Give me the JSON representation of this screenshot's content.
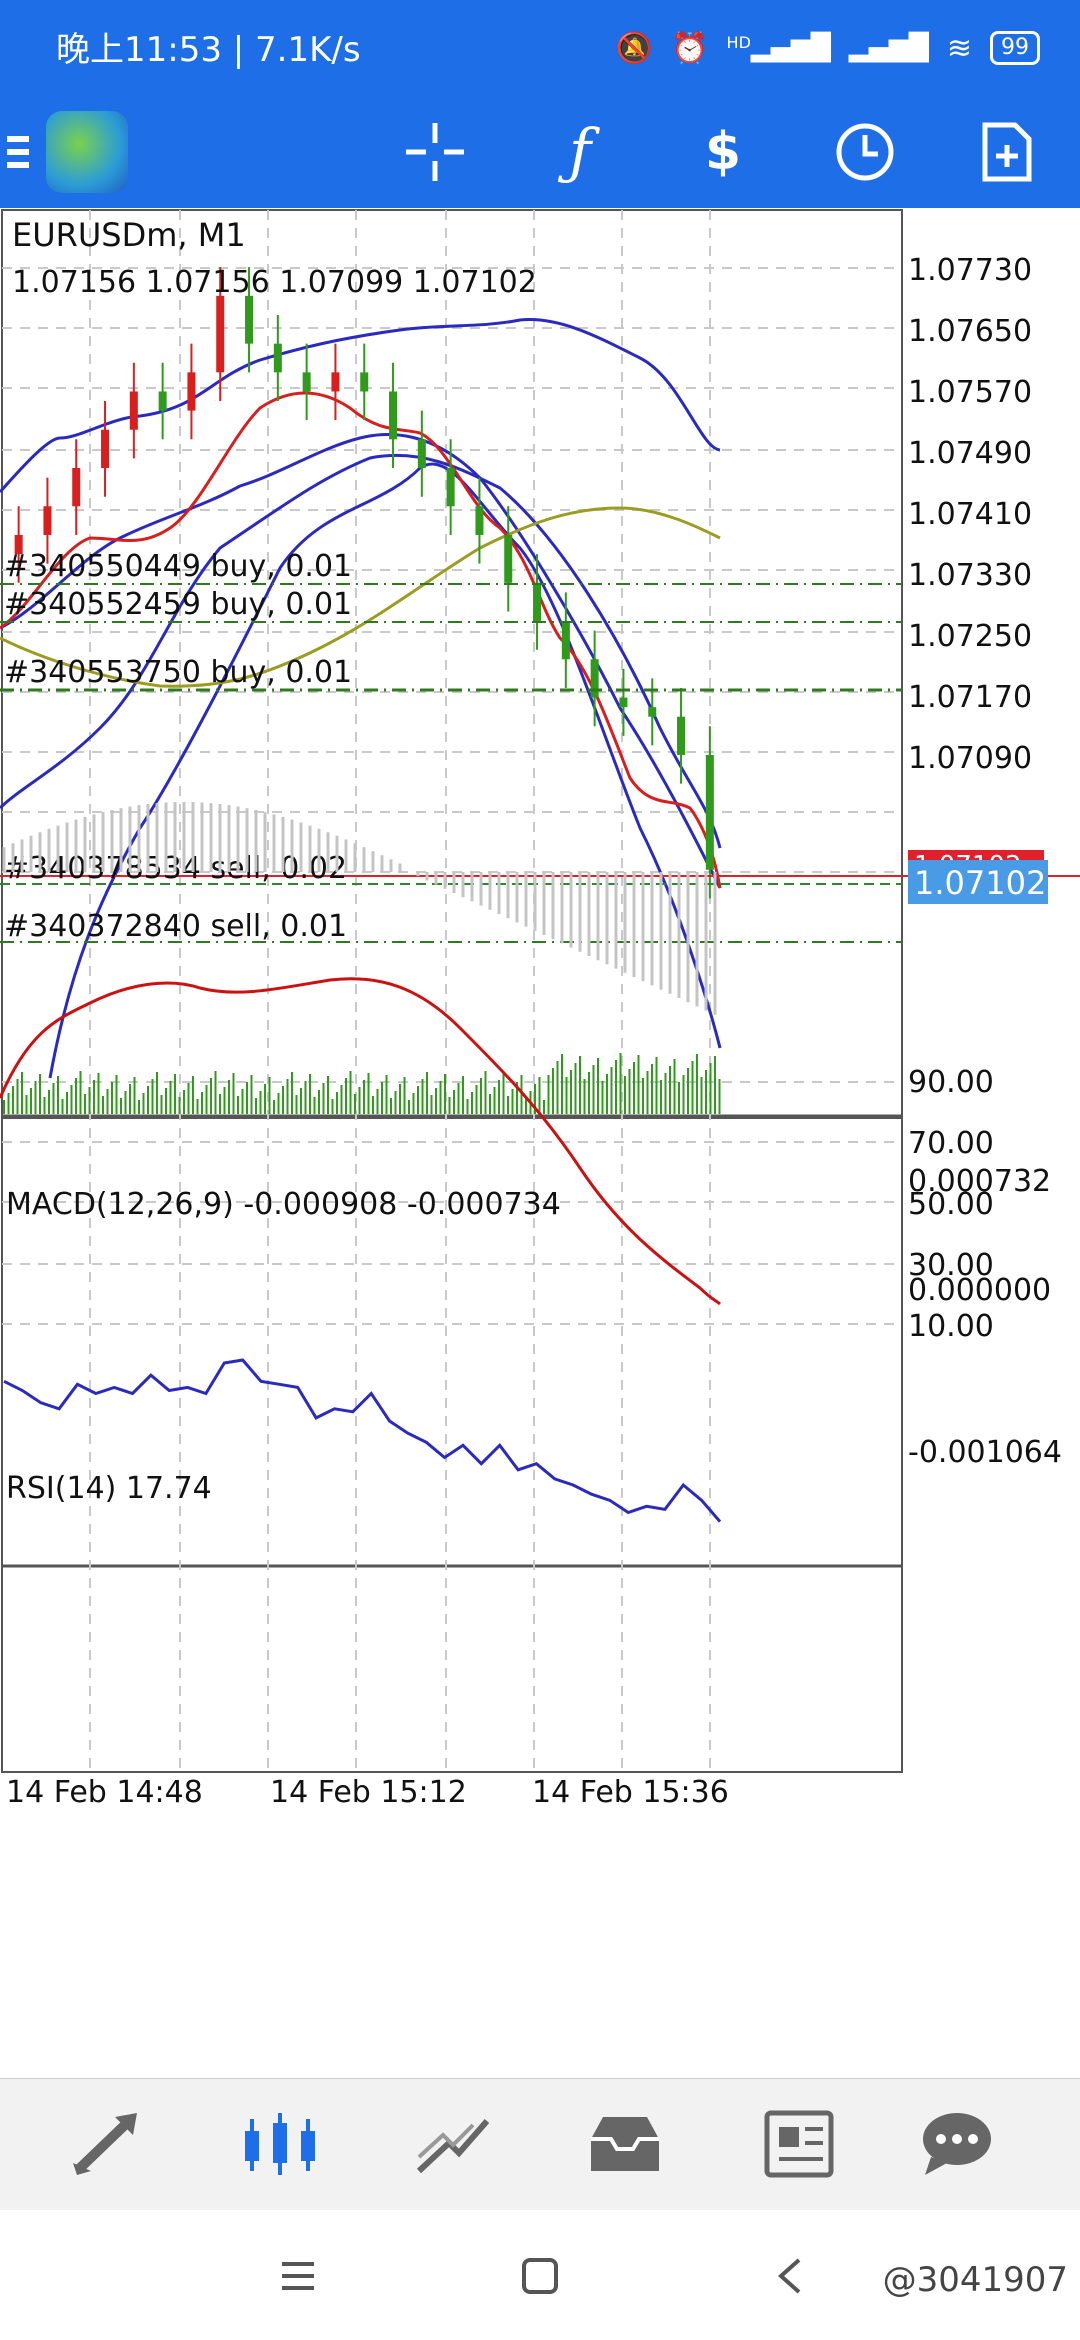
{
  "status_bar": {
    "time_text": "晚上11:53 | 7.1K/s",
    "signal_badge": "HD",
    "battery": "99"
  },
  "toolbar": {
    "icons": [
      "menu-icon",
      "app-logo",
      "crosshair-icon",
      "indicators-icon",
      "trade-icon",
      "timeframe-icon",
      "templates-icon"
    ]
  },
  "chart": {
    "symbol_label": "EURUSDm, M1",
    "ohlc_label": "1.07156 1.07156 1.07099 1.07102",
    "price_ticks": [
      "1.07730",
      "1.07650",
      "1.07570",
      "1.07490",
      "1.07410",
      "1.07330",
      "1.07250",
      "1.07170",
      "1.07090"
    ],
    "current_price": "1.07102",
    "red_tag": "1.07102",
    "orders": [
      {
        "label": "#340550449 buy, 0.01"
      },
      {
        "label": "#340552459 buy, 0.01"
      },
      {
        "label": "#340553750 buy, 0.01"
      },
      {
        "label": "#340378534 sell, 0.02"
      },
      {
        "label": "#340372840 sell, 0.01"
      }
    ],
    "macd_label": "MACD(12,26,9) -0.000908 -0.000734",
    "macd_ticks": [
      "0.000732",
      "0.000000",
      "-0.001064"
    ],
    "rsi_label": "RSI(14) 17.74",
    "rsi_ticks": [
      "90.00",
      "70.00",
      "50.00",
      "30.00",
      "10.00"
    ],
    "time_labels": [
      "14 Feb 14:48",
      "14 Feb 15:12",
      "14 Feb 15:36"
    ],
    "colors": {
      "bull": "#d91e1e",
      "bear": "#2f9a1c",
      "bands": "#2a2ac0",
      "ma": "#9c9c22",
      "macd_signal": "#cc1111",
      "grid": "#c9c9c9"
    }
  },
  "chart_data": {
    "type": "line",
    "rsi": [
      64,
      61,
      57,
      55,
      63,
      60,
      62,
      60,
      66,
      61,
      62,
      60,
      70,
      71,
      64,
      63,
      62,
      52,
      55,
      54,
      60,
      51,
      47,
      44,
      39,
      43,
      37,
      43,
      35,
      37,
      32,
      30,
      27,
      25,
      21,
      23,
      22,
      30,
      25,
      18
    ],
    "close_approx": [
      1.0745,
      1.0748,
      1.0752,
      1.0756,
      1.076,
      1.0758,
      1.0762,
      1.077,
      1.0765,
      1.0762,
      1.076,
      1.0762,
      1.076,
      1.0755,
      1.0752,
      1.0748,
      1.0745,
      1.074,
      1.0736,
      1.0732,
      1.0728,
      1.0727,
      1.0726,
      1.0722,
      1.071
    ]
  },
  "bottom_nav": [
    "quotes-icon",
    "chart-icon",
    "trade-icon",
    "history-icon",
    "news-icon",
    "messages-icon"
  ],
  "watermark": "@3041907"
}
